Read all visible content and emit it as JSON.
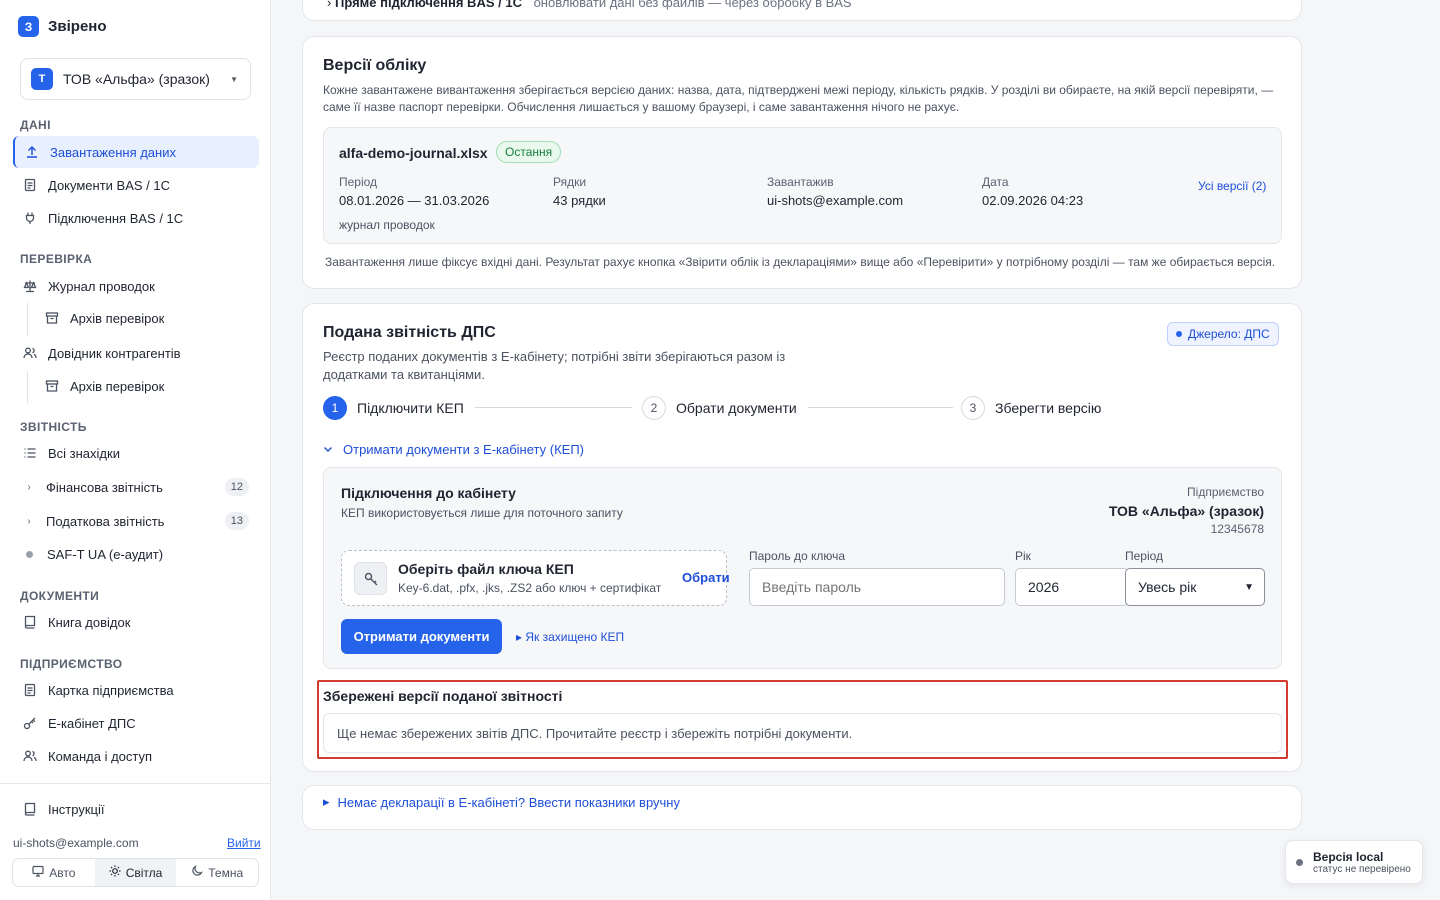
{
  "app": {
    "logo_letter": "З",
    "name": "Звірено"
  },
  "org": {
    "avatar_letter": "Т",
    "name": "ТОВ «Альфа» (зразок)"
  },
  "sidebar": {
    "sections": {
      "data": "ДАНІ",
      "check": "ПЕРЕВІРКА",
      "reports": "ЗВІТНІСТЬ",
      "docs": "ДОКУМЕНТИ",
      "enterprise": "ПІДПРИЄМСТВО"
    },
    "items": {
      "upload": "Завантаження даних",
      "bas_docs": "Документи BAS / 1С",
      "bas_connect": "Підключення BAS / 1С",
      "journal": "Журнал проводок",
      "journal_archive": "Архів перевірок",
      "contractors": "Довідник контрагентів",
      "contractors_archive": "Архів перевірок",
      "all_findings": "Всі знахідки",
      "financial": "Фінансова звітність",
      "financial_count": "12",
      "tax": "Податкова звітність",
      "tax_count": "13",
      "saft": "SAF-T UA (е-аудит)",
      "ref_book": "Книга довідок",
      "company_card": "Картка підприємства",
      "e_cabinet": "Е-кабінет ДПС",
      "team": "Команда і доступ",
      "instructions": "Інструкції"
    },
    "user_email": "ui-shots@example.com",
    "logout": "Вийти",
    "theme": {
      "auto": "Авто",
      "light": "Світла",
      "dark": "Темна",
      "selected": "Світла"
    }
  },
  "top_card": {
    "title": "Пряме підключення BAS / 1С",
    "subtitle": "оновлювати дані без файлів — через обробку в BAS"
  },
  "versions": {
    "title": "Версії обліку",
    "description_1": "Кожне завантажене вивантаження зберігається версією даних: назва, дата, підтверджені межі періоду, кількість рядків. У розділі ви обираєте, на якій версії перевіряти, —",
    "description_2": "саме її назве паспорт перевірки. Обчислення лишається у вашому браузері, і саме завантаження нічого не рахує.",
    "file_name": "alfa-demo-journal.xlsx",
    "latest_badge": "Остання",
    "period_label": "Період",
    "period_value": "08.01.2026 — 31.03.2026",
    "rows_label": "Рядки",
    "rows_value": "43 рядки",
    "uploader_label": "Завантажив",
    "uploader_value": "ui-shots@example.com",
    "date_label": "Дата",
    "date_value": "02.09.2026 04:23",
    "kind": "журнал проводок",
    "all_versions_link": "Усі версії (2)",
    "footnote": "Завантаження лише фіксує вхідні дані. Результат рахує кнопка «Звірити облік із деклараціями» вище або «Перевірити» у потрібному розділі — там же обирається версія."
  },
  "dps": {
    "title": "Подана звітність ДПС",
    "source_badge": "Джерело: ДПС",
    "description_1": "Реєстр поданих документів з Е-кабінету; потрібні звіти зберігаються разом із",
    "description_2": "додатками та квитанціями.",
    "steps": [
      {
        "num": "1",
        "label": "Підключити КЕП"
      },
      {
        "num": "2",
        "label": "Обрати документи"
      },
      {
        "num": "3",
        "label": "Зберегти версію"
      }
    ],
    "expander": "Отримати документи з Е-кабінету (КЕП)",
    "connect_title": "Підключення до кабінету",
    "connect_sub": "КЕП використовується лише для поточного запиту",
    "enterprise_label": "Підприємство",
    "enterprise_name": "ТОВ «Альфа» (зразок)",
    "enterprise_code": "12345678",
    "key_title": "Оберіть файл ключа КЕП",
    "key_hint": "Key-6.dat, .pfx, .jks, .ZS2 або ключ + сертифікат",
    "key_choose": "Обрати",
    "password_label": "Пароль до ключа",
    "password_placeholder": "Введіть пароль",
    "year_label": "Рік",
    "year_value": "2026",
    "period_label": "Період",
    "period_value": "Увесь рік",
    "fetch_button": "Отримати документи",
    "how_link": "Як захищено КЕП",
    "saved_title": "Збережені версії поданої звітності",
    "saved_empty": "Ще немає збережених звітів ДПС. Прочитайте реєстр і збережіть потрібні документи."
  },
  "manual": {
    "link": "Немає декларації в Е-кабінеті? Ввести показники вручну"
  },
  "toast": {
    "title": "Версія local",
    "subtitle": "статус не перевірено"
  },
  "colors": {
    "accent": "#2563eb",
    "highlight": "#d23b2f",
    "success": "#16803c"
  }
}
